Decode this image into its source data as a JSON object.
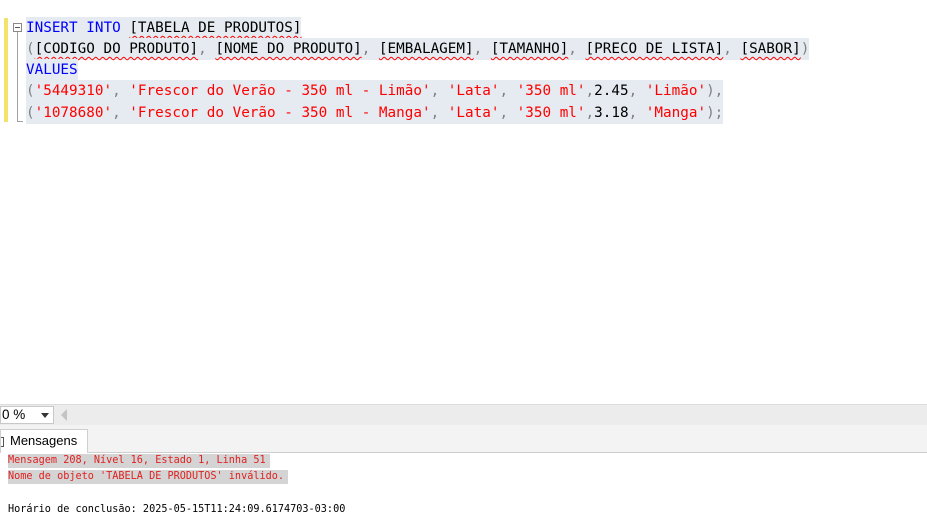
{
  "editor": {
    "lines": [
      [
        {
          "t": "INSERT",
          "c": "kw"
        },
        {
          "t": " ",
          "c": "tx"
        },
        {
          "t": "INTO",
          "c": "kw"
        },
        {
          "t": " ",
          "c": "tx"
        },
        {
          "t": "[TABELA DE PRODUTOS]",
          "c": "tx",
          "u": true
        }
      ],
      [
        {
          "t": "(",
          "c": "pn"
        },
        {
          "t": "[CODIGO DO PRODUTO]",
          "c": "tx",
          "u": true
        },
        {
          "t": ", ",
          "c": "pn"
        },
        {
          "t": "[NOME DO PRODUTO]",
          "c": "tx",
          "u": true
        },
        {
          "t": ", ",
          "c": "pn"
        },
        {
          "t": "[EMBALAGEM]",
          "c": "tx",
          "u": true
        },
        {
          "t": ", ",
          "c": "pn"
        },
        {
          "t": "[TAMANHO]",
          "c": "tx",
          "u": true
        },
        {
          "t": ", ",
          "c": "pn"
        },
        {
          "t": "[PRECO DE LISTA]",
          "c": "tx",
          "u": true
        },
        {
          "t": ", ",
          "c": "pn"
        },
        {
          "t": "[SABOR]",
          "c": "tx",
          "u": true
        },
        {
          "t": ")",
          "c": "pn"
        }
      ],
      [
        {
          "t": "VALUES",
          "c": "kw"
        }
      ],
      [
        {
          "t": "(",
          "c": "pn"
        },
        {
          "t": "'5449310'",
          "c": "str"
        },
        {
          "t": ", ",
          "c": "pn"
        },
        {
          "t": "'Frescor do Verão - 350 ml - Limão'",
          "c": "str"
        },
        {
          "t": ", ",
          "c": "pn"
        },
        {
          "t": "'Lata'",
          "c": "str"
        },
        {
          "t": ", ",
          "c": "pn"
        },
        {
          "t": "'350 ml'",
          "c": "str"
        },
        {
          "t": ",",
          "c": "pn"
        },
        {
          "t": "2.45",
          "c": "tx"
        },
        {
          "t": ", ",
          "c": "pn"
        },
        {
          "t": "'Limão'",
          "c": "str"
        },
        {
          "t": "),",
          "c": "pn"
        }
      ],
      [
        {
          "t": "(",
          "c": "pn"
        },
        {
          "t": "'1078680'",
          "c": "str"
        },
        {
          "t": ", ",
          "c": "pn"
        },
        {
          "t": "'Frescor do Verão - 350 ml - Manga'",
          "c": "str"
        },
        {
          "t": ", ",
          "c": "pn"
        },
        {
          "t": "'Lata'",
          "c": "str"
        },
        {
          "t": ", ",
          "c": "pn"
        },
        {
          "t": "'350 ml'",
          "c": "str"
        },
        {
          "t": ",",
          "c": "pn"
        },
        {
          "t": "3.18",
          "c": "tx"
        },
        {
          "t": ", ",
          "c": "pn"
        },
        {
          "t": "'Manga'",
          "c": "str"
        },
        {
          "t": ");",
          "c": "pn"
        }
      ]
    ]
  },
  "zoom": {
    "value": "0 %"
  },
  "results": {
    "tab_label": "Mensagens",
    "error_line_1": "Mensagem 208, Nível 16, Estado 1, Linha 51",
    "error_line_2": "Nome de objeto 'TABELA DE PRODUTOS' inválido.",
    "completion": "Horário de conclusão: 2025-05-15T11:24:09.6174703-03:00"
  },
  "colors": {
    "keyword": "#0000ff",
    "string": "#ff0000",
    "error_text": "#e02020",
    "selection": "#e5ebf1",
    "change_margin": "#f2e36a"
  }
}
